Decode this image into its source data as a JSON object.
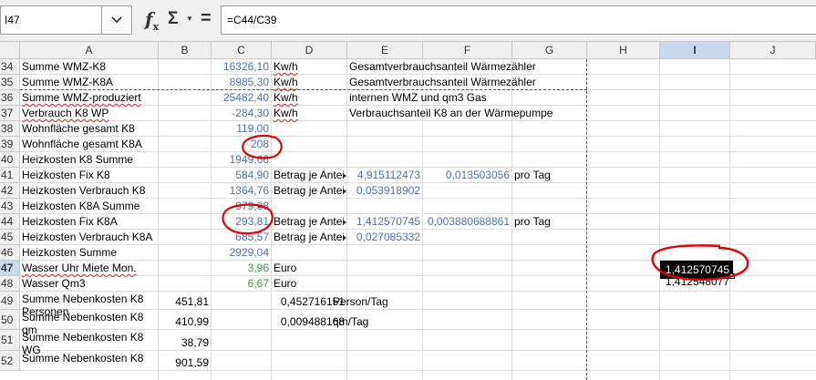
{
  "toolbar": {
    "name_box": "I47",
    "formula": "=C44/C39",
    "fx": "f",
    "fx_sub": "x",
    "sigma": "Σ",
    "equals": "="
  },
  "columns": [
    "A",
    "B",
    "C",
    "D",
    "E",
    "F",
    "G",
    "H",
    "I",
    "J"
  ],
  "selected_column": "I",
  "selected_row": "47",
  "rows": [
    {
      "n": "34",
      "A": "Summe WMZ-K8",
      "C": "16326,10",
      "D": "Kw/h",
      "E": "Gesamtverbrauchsanteil Wärmezähler"
    },
    {
      "n": "35",
      "A": "Summe WMZ-K8A",
      "C": "8985,30",
      "D": "Kw/h",
      "E": "Gesamtverbrauchsanteil Wärmezähler"
    },
    {
      "n": "36",
      "A": "Summe WMZ-produziert",
      "C": "25482,40",
      "D": "Kw/h",
      "E": "internen WMZ und qm3 Gas"
    },
    {
      "n": "37",
      "A": "Verbrauch K8 WP",
      "C": "-284,30",
      "D": "Kw/h",
      "E": "Verbrauchsanteil K8 an der Wärmepumpe"
    },
    {
      "n": "38",
      "A": "Wohnfläche gesamt K8",
      "C": "119,00"
    },
    {
      "n": "39",
      "A": "Wohnfläche gesamt K8A",
      "C": "208"
    },
    {
      "n": "40",
      "A": "Heizkosten K8 Summe",
      "C": "1949,66"
    },
    {
      "n": "41",
      "A": "Heizkosten Fix K8",
      "C": "584,90",
      "D": "Betrag je Anteil",
      "E": "4,915112473",
      "F": "0,013503056",
      "G": "pro Tag"
    },
    {
      "n": "42",
      "A": "Heizkosten Verbrauch K8",
      "C": "1364,76",
      "D": "Betrag je Anteil",
      "E": "0,053918902"
    },
    {
      "n": "43",
      "A": "Heizkosten K8A Summe",
      "C": "979,38"
    },
    {
      "n": "44",
      "A": "Heizkosten Fix K8A",
      "C": "293,81",
      "D": "Betrag je Anteil",
      "E": "1,412570745",
      "F": "0,003880688861",
      "G": "pro Tag"
    },
    {
      "n": "45",
      "A": "Heizkosten Verbrauch K8A",
      "C": "685,57",
      "D": "Betrag je Anteil",
      "E": "0,027085332"
    },
    {
      "n": "46",
      "A": "Heizkosten Summe",
      "C": "2929,04"
    },
    {
      "n": "47",
      "A": "Wasser Uhr Miete Mon.",
      "C": "3,96",
      "D": "Euro",
      "I": "1,412570745"
    },
    {
      "n": "48",
      "A": "Wasser Qm3",
      "C": "6,67",
      "D": "Euro",
      "I": "1,412548077"
    },
    {
      "n": "49",
      "A": "Summe Nebenkosten K8 Personen",
      "B": "451,81",
      "D": "0,452716151",
      "D2": "Person/Tag"
    },
    {
      "n": "50",
      "A": "Summe Nebenkosten K8 qm",
      "B": "410,99",
      "D": "0,009488168",
      "D2": "qm/Tag"
    },
    {
      "n": "51",
      "A": "Summe Nebenkosten K8 WG",
      "B": "38,79"
    },
    {
      "n": "52",
      "A": "Summe Nebenkosten K8",
      "B": "901,59"
    }
  ],
  "colors": {
    "blue_values": "#4a74b4",
    "green_values": "#3a9c3a",
    "annotation_red": "#e00000",
    "selection_header": "#c8d9ee"
  }
}
